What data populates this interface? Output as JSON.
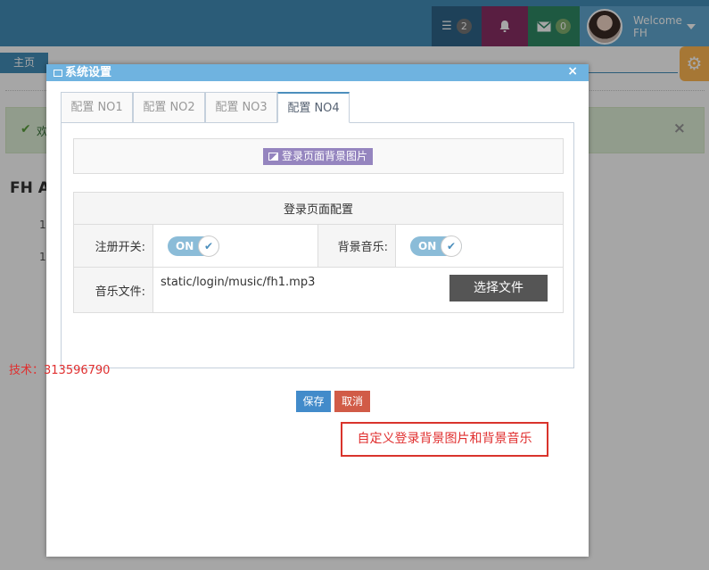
{
  "navbar": {
    "tasks_badge": "2",
    "mail_badge": "0",
    "user_greeting": "Welcome",
    "user_name": "FH"
  },
  "background": {
    "home_tab": "主页",
    "alert_text": "欢",
    "title_fragment": "FH A",
    "list_numbers": [
      "1",
      "1"
    ]
  },
  "modal": {
    "title": "系统设置",
    "close_label": "×",
    "tabs": [
      {
        "label": "配置 NO1",
        "active": false
      },
      {
        "label": "配置 NO2",
        "active": false
      },
      {
        "label": "配置 NO3",
        "active": false
      },
      {
        "label": "配置 NO4",
        "active": true
      }
    ],
    "bg_image_button": "登录页面背景图片",
    "config_header": "登录页面配置",
    "register_label": "注册开关:",
    "register_toggle": "ON",
    "music_label": "背景音乐:",
    "music_toggle": "ON",
    "music_file_label": "音乐文件:",
    "music_file_value": "static/login/music/fh1.mp3",
    "choose_file_button": "选择文件",
    "save_button": "保存",
    "cancel_button": "取消"
  },
  "annotations": {
    "tech_contact": "技术：313596790",
    "note": "自定义登录背景图片和背景音乐"
  },
  "colors": {
    "navbar": "#438eb9",
    "modal_header": "#6fb3e0",
    "bg_button": "#9585bf",
    "save": "#428bca",
    "cancel": "#d15b47",
    "annotation_red": "#e02f2f"
  }
}
